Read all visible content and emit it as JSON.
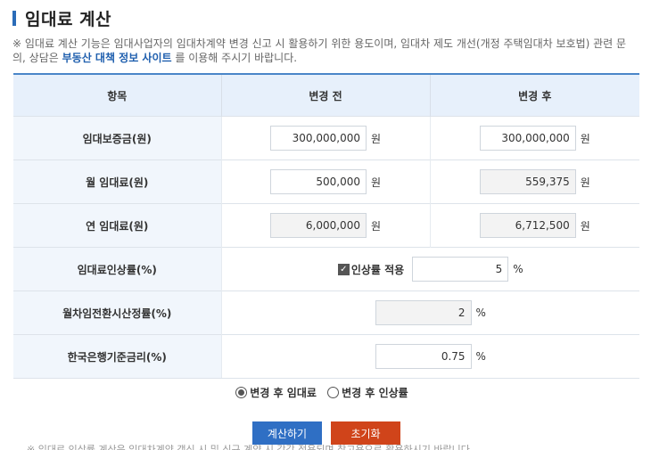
{
  "header": {
    "title": "임대료 계산"
  },
  "notice": {
    "part1": "※ 임대료 계산 기능은 임대사업자의 임대차계약 변경 신고 시 활용하기 위한 용도이며, 임대차 제도 개선(개정 주택임대차 보호법) 관련 문의, 상담은 ",
    "link": "부동산 대책 정보 사이트",
    "part2": " 를 이용해 주시기 바랍니다."
  },
  "table": {
    "headers": [
      "항목",
      "변경 전",
      "변경 후"
    ],
    "rows": {
      "deposit": {
        "label": "임대보증금(원)",
        "before": "300,000,000",
        "after": "300,000,000",
        "unit": "원"
      },
      "monthly": {
        "label": "월 임대료(원)",
        "before": "500,000",
        "after": "559,375",
        "unit": "원"
      },
      "yearly": {
        "label": "연 임대료(원)",
        "before": "6,000,000",
        "after": "6,712,500",
        "unit": "원"
      },
      "rate": {
        "label": "임대료인상률(%)",
        "checkbox_label": "인상률 적용",
        "value": "5",
        "unit": "%"
      },
      "conversion": {
        "label": "월차임전환시산정률(%)",
        "value": "2",
        "unit": "%"
      },
      "bok": {
        "label": "한국은행기준금리(%)",
        "value": "0.75",
        "unit": "%"
      }
    }
  },
  "options": {
    "radio1": "변경 후 임대료",
    "radio2": "변경 후 인상률"
  },
  "buttons": {
    "calc": "계산하기",
    "reset": "초기화"
  },
  "footer": {
    "cut_text": "※ 임대료 인상률 계산은 임대차계약 갱신 시 및 신규 계약 시 각각 적용되며 참고용으로 활용하시기 바랍니다."
  }
}
